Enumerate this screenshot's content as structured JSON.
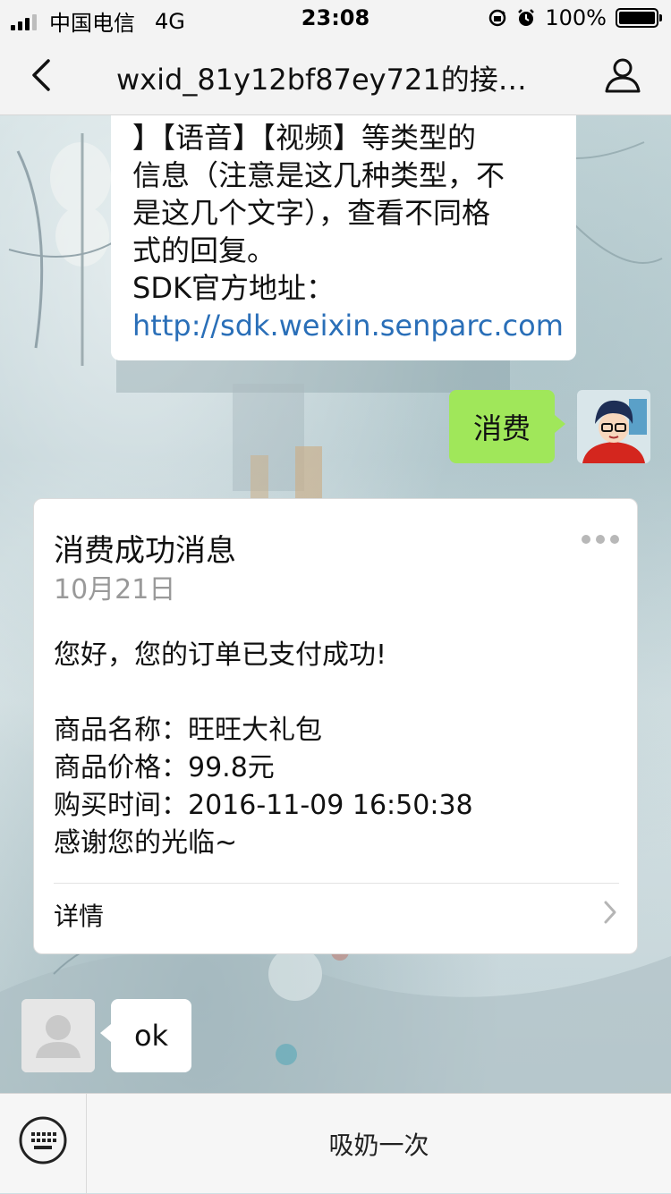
{
  "status_bar": {
    "carrier": "中国电信",
    "network": "4G",
    "time": "23:08",
    "battery": "100%",
    "battery_level": 1.0
  },
  "nav": {
    "title": "wxid_81y12bf87ey721的接口…",
    "back_icon": "chevron-left-icon",
    "profile_icon": "person-icon"
  },
  "messages": {
    "top_incoming": {
      "line1": "】【语音】【视频】等类型的",
      "line2": "信息（注意是这几种类型，不",
      "line3": "是这几个文字），查看不同格",
      "line4": "式的回复。",
      "line5": "SDK官方地址：",
      "link": "http://sdk.weixin.senparc.com"
    },
    "outgoing": {
      "text": "消费"
    },
    "card": {
      "title": "消费成功消息",
      "date": "10月21日",
      "greeting": "您好，您的订单已支付成功!",
      "product_name": "商品名称：旺旺大礼包",
      "product_price": "商品价格：99.8元",
      "purchase_time": "购买时间：2016-11-09 16:50:38",
      "thanks": "感谢您的光临~",
      "detail": "详情"
    },
    "incoming_ok": {
      "text": "ok"
    }
  },
  "bottom_bar": {
    "menu_label": "吸奶一次"
  },
  "colors": {
    "outgoing_bubble": "#a0e75a",
    "link": "#2a6fb8"
  }
}
